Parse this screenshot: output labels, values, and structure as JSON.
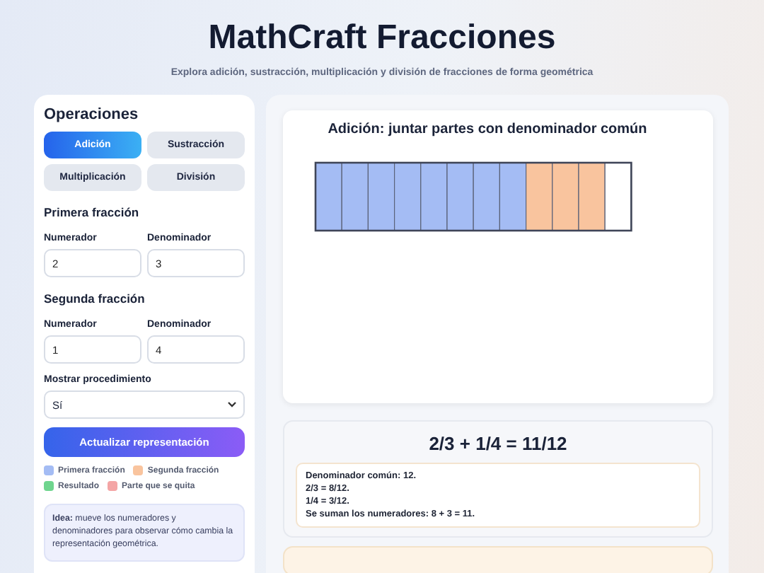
{
  "header": {
    "title": "MathCraft Fracciones",
    "subtitle": "Explora adición, sustracción, multiplicación y división de fracciones de forma geométrica"
  },
  "sidebar": {
    "heading": "Operaciones",
    "operations": [
      {
        "label": "Adición",
        "selected": true
      },
      {
        "label": "Sustracción",
        "selected": false
      },
      {
        "label": "Multiplicación",
        "selected": false
      },
      {
        "label": "División",
        "selected": false
      }
    ],
    "fractions": [
      {
        "heading": "Primera fracción",
        "numerator_label": "Numerador",
        "numerator": "2",
        "denominator_label": "Denominador",
        "denominator": "3"
      },
      {
        "heading": "Segunda fracción",
        "numerator_label": "Numerador",
        "numerator": "1",
        "denominator_label": "Denominador",
        "denominator": "4"
      }
    ],
    "procedure_label": "Mostrar procedimiento",
    "procedure_value": "Sí",
    "update_button": "Actualizar representación",
    "legend": [
      {
        "label": "Primera fracción",
        "color": "#a4bcf4"
      },
      {
        "label": "Segunda fracción",
        "color": "#f9c49e"
      },
      {
        "label": "Resultado",
        "color": "#6fd58e"
      },
      {
        "label": "Parte que se quita",
        "color": "#f4a5a5"
      }
    ],
    "tip": "**Idea:** mueve los numeradores y denominadores para observar cómo cambia la representación geométrica."
  },
  "canvas": {
    "title": "Adición: juntar partes con denominador común",
    "cells": [
      {
        "kind": "first"
      },
      {
        "kind": "first"
      },
      {
        "kind": "first"
      },
      {
        "kind": "first"
      },
      {
        "kind": "first"
      },
      {
        "kind": "first"
      },
      {
        "kind": "first"
      },
      {
        "kind": "first"
      },
      {
        "kind": "second"
      },
      {
        "kind": "second"
      },
      {
        "kind": "second"
      },
      {
        "kind": "empty"
      }
    ]
  },
  "result": {
    "equation": "2/3 + 1/4 = 11/12",
    "steps": [
      "Denominador común: 12.",
      "2/3 = 8/12.",
      "1/4 = 3/12.",
      "Se suman los numeradores: 8 + 3 = 11."
    ]
  }
}
